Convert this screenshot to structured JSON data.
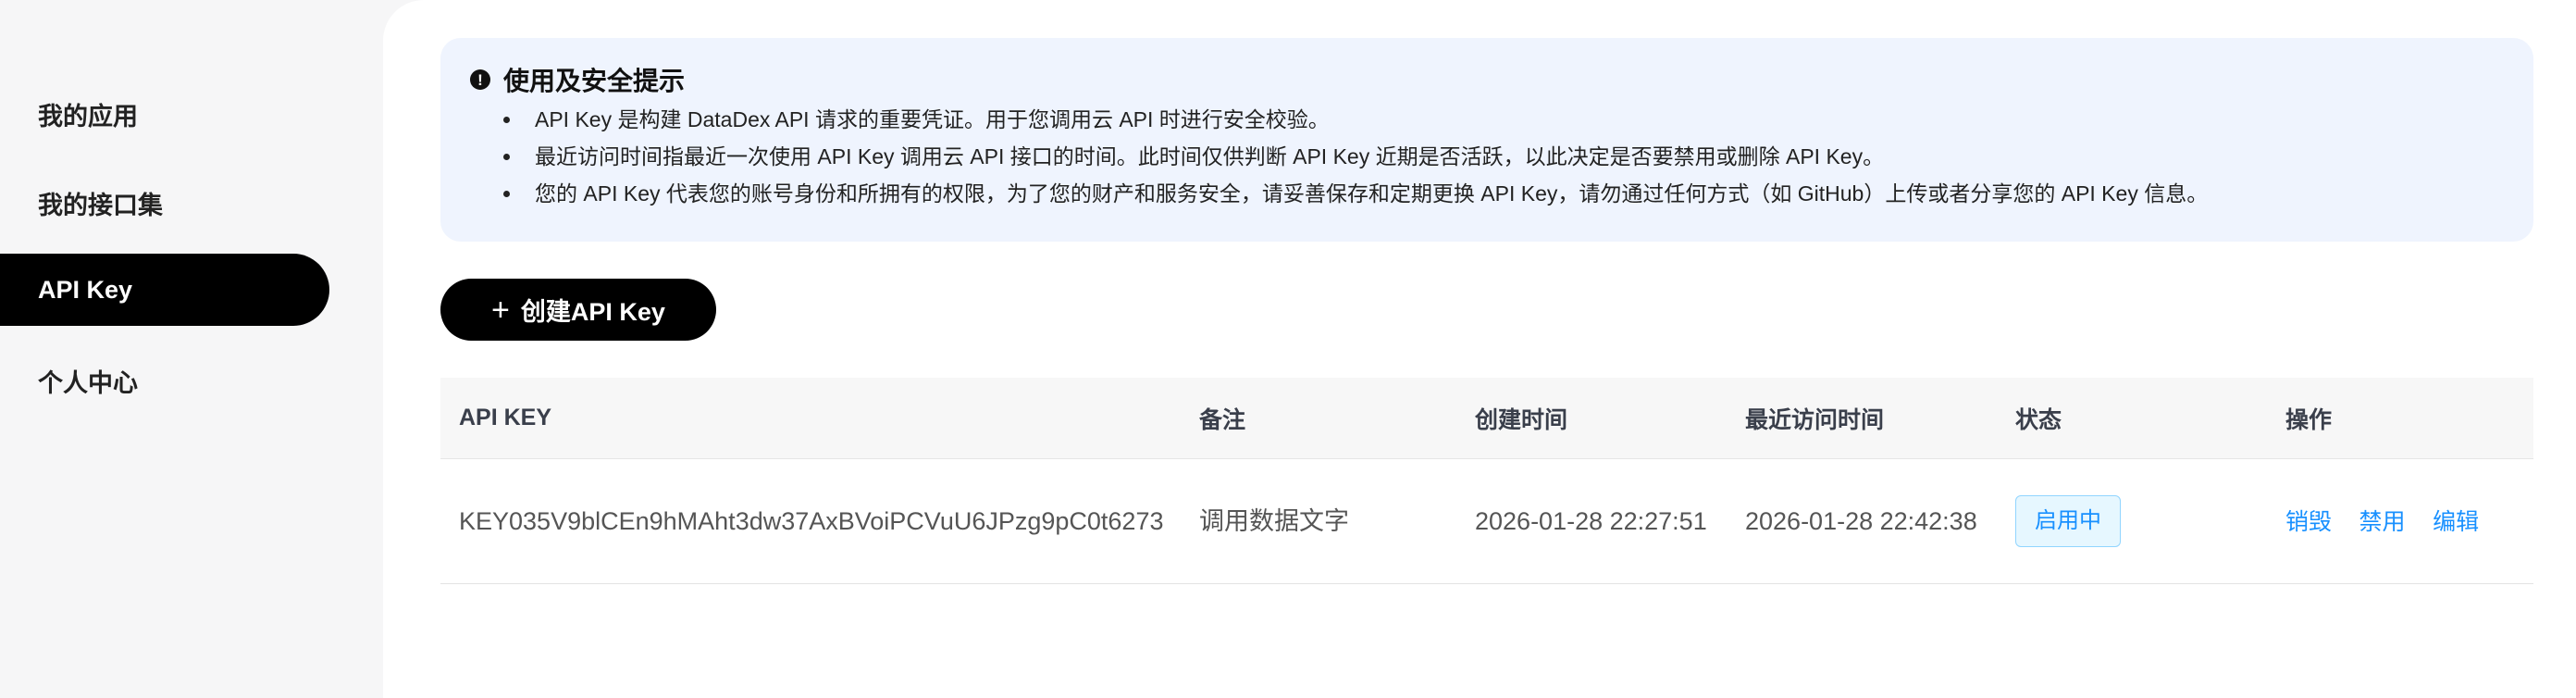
{
  "sidebar": {
    "items": [
      {
        "label": "我的应用"
      },
      {
        "label": "我的接口集"
      },
      {
        "label": "API Key"
      },
      {
        "label": "个人中心"
      }
    ]
  },
  "notice": {
    "icon": "exclamation-icon",
    "title": "使用及安全提示",
    "items": [
      "API Key 是构建 DataDex API 请求的重要凭证。用于您调用云 API 时进行安全校验。",
      "最近访问时间指最近一次使用 API Key 调用云 API 接口的时间。此时间仅供判断 API Key 近期是否活跃，以此决定是否要禁用或删除 API Key。",
      "您的 API Key 代表您的账号身份和所拥有的权限，为了您的财产和服务安全，请妥善保存和定期更换 API Key，请勿通过任何方式（如 GitHub）上传或者分享您的 API Key 信息。"
    ]
  },
  "create_button": {
    "icon": "plus-icon",
    "label": "创建API Key"
  },
  "table": {
    "headers": [
      "API KEY",
      "备注",
      "创建时间",
      "最近访问时间",
      "状态",
      "操作"
    ],
    "rows": [
      {
        "key": "KEY035V9blCEn9hMAht3dw37AxBVoiPCVuU6JPzg9pC0t6273",
        "note": "调用数据文字",
        "created": "2026-01-28 22:27:51",
        "last_access": "2026-01-28 22:42:38",
        "status": "启用中",
        "actions": [
          "销毁",
          "禁用",
          "编辑"
        ]
      }
    ]
  },
  "colors": {
    "accent": "#1890ff",
    "active_nav": "#000000",
    "notice_bg": "#eff4fe"
  }
}
